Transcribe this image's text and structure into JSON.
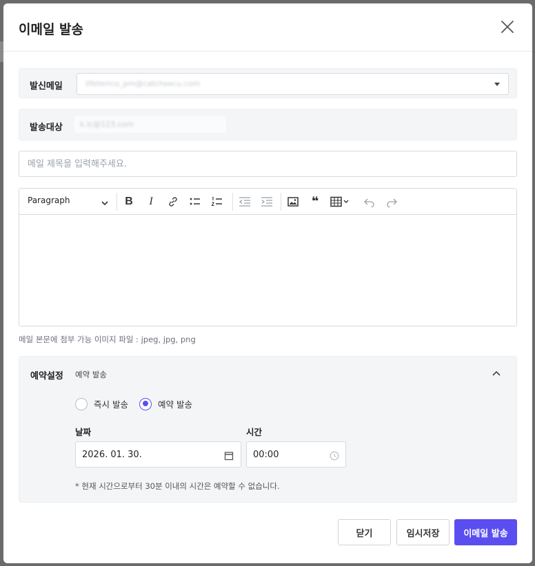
{
  "modal": {
    "title": "이메일 발송"
  },
  "sender": {
    "label": "발신메일",
    "value": "lifeterrco_pm@catchsecu.com"
  },
  "target": {
    "label": "발송대상",
    "value": "k.ic@123.com"
  },
  "subject": {
    "placeholder": "메일 제목을 입력해주세요.",
    "value": ""
  },
  "editor": {
    "paragraph_label": "Paragraph",
    "toolbar_icons": [
      "bold-icon",
      "italic-icon",
      "link-icon",
      "bulleted-list-icon",
      "numbered-list-icon",
      "outdent-icon",
      "indent-icon",
      "image-icon",
      "quote-icon",
      "table-icon",
      "undo-icon",
      "redo-icon"
    ],
    "bold_glyph": "B",
    "italic_glyph": "I",
    "quote_glyph": "❝"
  },
  "hint": "메일 본문에 첨부 가능 이미지 파일 : jpeg, jpg, png",
  "schedule": {
    "label": "예약설정",
    "mode_summary": "예약 발송",
    "options": [
      "즉시 발송",
      "예약 발송"
    ],
    "selected": "예약 발송",
    "date_label": "날짜",
    "date_value": "2026. 01. 30.",
    "time_label": "시간",
    "time_value": "00:00",
    "note": "* 현재 시간으로부터 30분 이내의 시간은 예약할 수 없습니다."
  },
  "buttons": {
    "close": "닫기",
    "draft": "임시저장",
    "send": "이메일 발송"
  },
  "colors": {
    "accent": "#5b4ef0"
  }
}
